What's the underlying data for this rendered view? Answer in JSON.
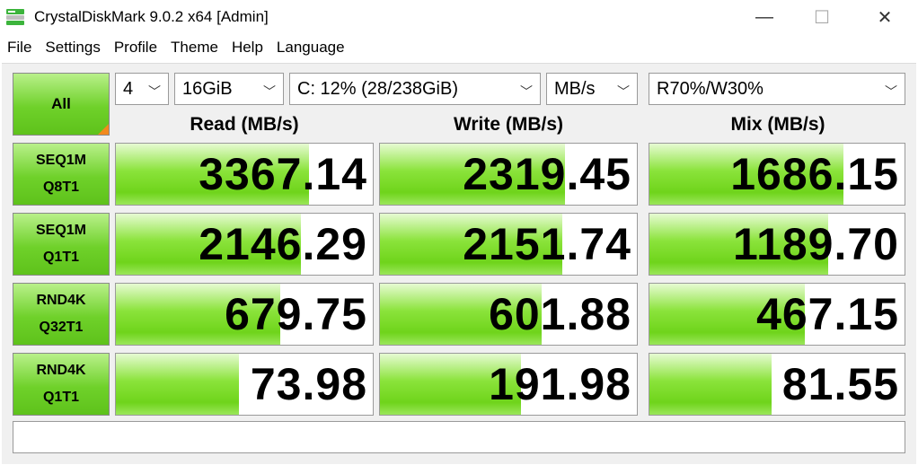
{
  "window": {
    "title": "CrystalDiskMark 9.0.2 x64 [Admin]",
    "minimize": "—",
    "maximize": "☐",
    "close": "✕"
  },
  "menu": [
    "File",
    "Settings",
    "Profile",
    "Theme",
    "Help",
    "Language"
  ],
  "controls": {
    "all_label": "All",
    "count": "4",
    "size": "16GiB",
    "drive": "C: 12% (28/238GiB)",
    "unit": "MB/s",
    "mix": "R70%/W30%"
  },
  "columns": [
    "Read (MB/s)",
    "Write (MB/s)",
    "Mix (MB/s)"
  ],
  "tests": [
    {
      "line1": "SEQ1M",
      "line2": "Q8T1",
      "read": "3367.14",
      "write": "2319.45",
      "mix": "1686.15",
      "read_fill": 0.75,
      "write_fill": 0.72,
      "mix_fill": 0.76
    },
    {
      "line1": "SEQ1M",
      "line2": "Q1T1",
      "read": "2146.29",
      "write": "2151.74",
      "mix": "1189.70",
      "read_fill": 0.72,
      "write_fill": 0.71,
      "mix_fill": 0.7
    },
    {
      "line1": "RND4K",
      "line2": "Q32T1",
      "read": "679.75",
      "write": "601.88",
      "mix": "467.15",
      "read_fill": 0.64,
      "write_fill": 0.63,
      "mix_fill": 0.61
    },
    {
      "line1": "RND4K",
      "line2": "Q1T1",
      "read": "73.98",
      "write": "191.98",
      "mix": "81.55",
      "read_fill": 0.48,
      "write_fill": 0.55,
      "mix_fill": 0.48
    }
  ],
  "colors": {
    "accent_green": "#6fd12a",
    "corner_orange": "#f28a1e"
  }
}
